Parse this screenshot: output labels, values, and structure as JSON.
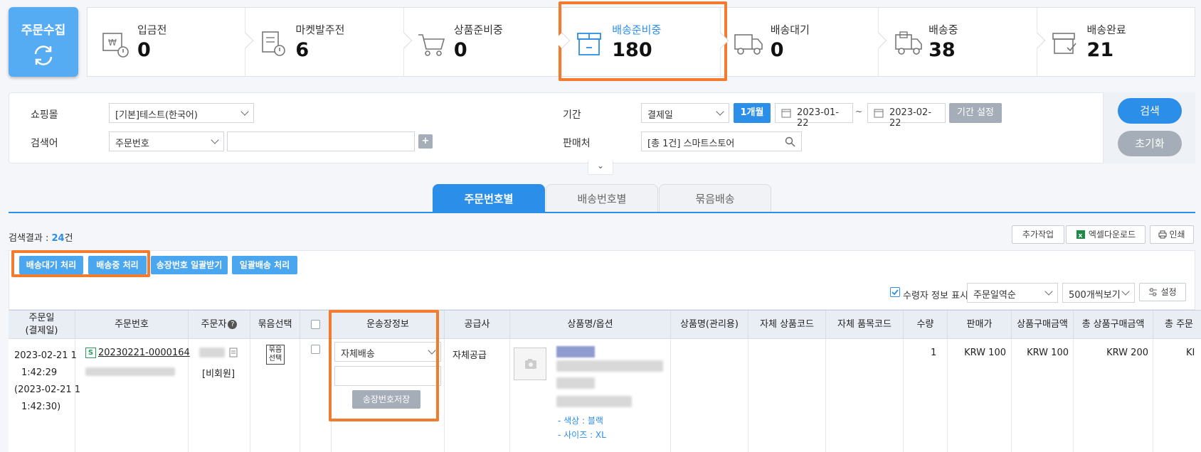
{
  "app": {
    "collect_label": "주문수집"
  },
  "statuses": [
    {
      "label": "입금전",
      "count": "0",
      "icon": "deposit-pending-icon"
    },
    {
      "label": "마켓발주전",
      "count": "6",
      "icon": "market-order-icon"
    },
    {
      "label": "상품준비중",
      "count": "0",
      "icon": "cart-icon"
    },
    {
      "label": "배송준비중",
      "count": "180",
      "icon": "box-icon",
      "active": true
    },
    {
      "label": "배송대기",
      "count": "0",
      "icon": "truck-icon"
    },
    {
      "label": "배송중",
      "count": "38",
      "icon": "truck-moving-icon"
    },
    {
      "label": "배송완료",
      "count": "21",
      "icon": "delivered-box-icon"
    }
  ],
  "search": {
    "mall_label": "쇼핑몰",
    "mall_value": "[기본]테스트(한국어)",
    "keyword_label": "검색어",
    "keyword_type": "주문번호",
    "keyword_value": "",
    "add_symbol": "+",
    "period_label": "기간",
    "period_type": "결제일",
    "period_preset": "1개월",
    "date_from": "2023-01-22",
    "date_sep": "~",
    "date_to": "2023-02-22",
    "period_set": "기간 설정",
    "seller_label": "판매처",
    "seller_value": "[총 1건] 스마트스토어",
    "search_button": "검색",
    "reset_button": "초기화",
    "expand_symbol": "⌄"
  },
  "tabs": [
    {
      "label": "주문번호별",
      "active": true
    },
    {
      "label": "배송번호별"
    },
    {
      "label": "묶음배송"
    }
  ],
  "results": {
    "label": "검색결과 : ",
    "count": "24",
    "unit": "건",
    "extra_work": "추가작업",
    "excel": "엑셀다운로드",
    "print": "인쇄"
  },
  "actions": [
    "배송대기 처리",
    "배송중 처리",
    "송장번호 일괄받기",
    "일괄배송 처리"
  ],
  "options": {
    "show_receiver": "수령자 정보 표시",
    "sort": "주문일역순",
    "page_size": "500개씩보기",
    "settings": "설정"
  },
  "table": {
    "headers": {
      "order_date": "주문일\n(결제일)",
      "order_no": "주문번호",
      "orderer": "주문자",
      "bundle": "묶음선택",
      "shipping": "운송장정보",
      "supplier": "공급사",
      "product": "상품명/옵션",
      "product_admin": "상품명(관리용)",
      "own_product_code": "자체 상품코드",
      "own_item_code": "자체 품목코드",
      "qty": "수량",
      "price": "판매가",
      "purchase": "상품구매금액",
      "total_purchase": "총 상품구매금액",
      "total_order": "총 주문"
    },
    "row": {
      "date_line1": "2023-02-21 1",
      "date_line2": "1:42:29",
      "date_line3": "(2023-02-21 1",
      "date_line4": "1:42:30)",
      "order_badge": "S",
      "order_no": "20230221-0000164",
      "orderer_type": "[비회원]",
      "bundle_btn": "묶음\n선택",
      "shipping_method": "자체배송",
      "tracking_value": "",
      "save_tracking": "송장번호저장",
      "supplier": "자체공급",
      "option_color": "- 색상 : 블랙",
      "option_size": "- 사이즈 : XL",
      "qty": "1",
      "price": "KRW 100",
      "purchase": "KRW 100",
      "total_purchase": "KRW 200",
      "total_order": "KI"
    }
  },
  "colors": {
    "accent": "#2b8ee8",
    "highlight": "#f37b2d",
    "collect": "#55acf2"
  }
}
